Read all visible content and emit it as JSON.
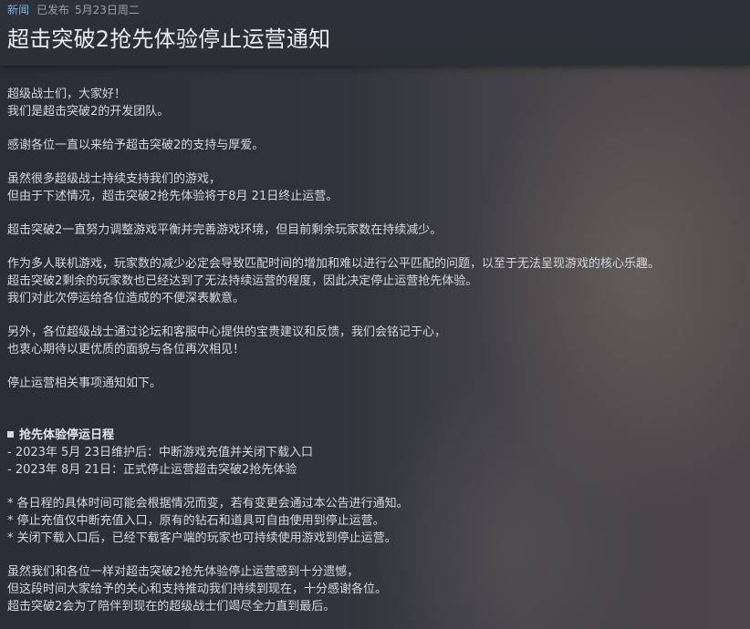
{
  "meta": {
    "tag": "新闻",
    "status": "已发布",
    "date": "5月23日周二"
  },
  "title": "超击突破2抢先体验停止运营通知",
  "body": {
    "greeting": [
      "超级战士们，大家好！",
      "我们是超击突破2的开发团队。"
    ],
    "thanks": [
      "感谢各位一直以来给予超击突破2的支持与厚爱。"
    ],
    "reason": [
      "虽然很多超级战士持续支持我们的游戏，",
      "但由于下述情况，超击突破2抢先体验将于8月 21日终止运营。"
    ],
    "balance": [
      "超击突破2一直努力调整游戏平衡并完善游戏环境，但目前剩余玩家数在持续减少。"
    ],
    "multiplayer": [
      "作为多人联机游戏，玩家数的减少必定会导致匹配时间的增加和难以进行公平匹配的问题，以至于无法呈现游戏的核心乐趣。",
      "超击突破2剩余的玩家数也已经达到了无法持续运营的程度，因此决定停止运营抢先体验。",
      "我们对此次停运给各位造成的不便深表歉意。"
    ],
    "feedback": [
      "另外，各位超级战士通过论坛和客服中心提供的宝贵建议和反馈，我们会铭记于心，",
      "也衷心期待以更优质的面貌与各位再次相见！"
    ],
    "details_intro": [
      "停止运营相关事项通知如下。"
    ],
    "schedule_title": "抢先体验停运日程",
    "schedule": [
      "- 2023年 5月 23日维护后：中断游戏充值并关闭下载入口",
      "- 2023年 8月 21日：正式停止运营超击突破2抢先体验"
    ],
    "notes": [
      "* 各日程的具体时间可能会根据情况而变，若有变更会通过本公告进行通知。",
      "* 停止充值仅中断充值入口，原有的钻石和道具可自由使用到停止运营。",
      "* 关闭下载入口后，已经下载客户端的玩家也可持续使用游戏到停止运营。"
    ],
    "closing": [
      "虽然我们和各位一样对超击突破2抢先体验停止运营感到十分遗憾，",
      "但这段时间大家给予的关心和支持推动我们持续到现在，十分感谢各位。",
      "超击突破2会为了陪伴到现在的超级战士们竭尽全力直到最后。"
    ]
  },
  "colors": {
    "tag": "#66b9f2",
    "meta": "#9aa1ab",
    "title": "#e9edf2",
    "body_text": "#d5d9df"
  }
}
